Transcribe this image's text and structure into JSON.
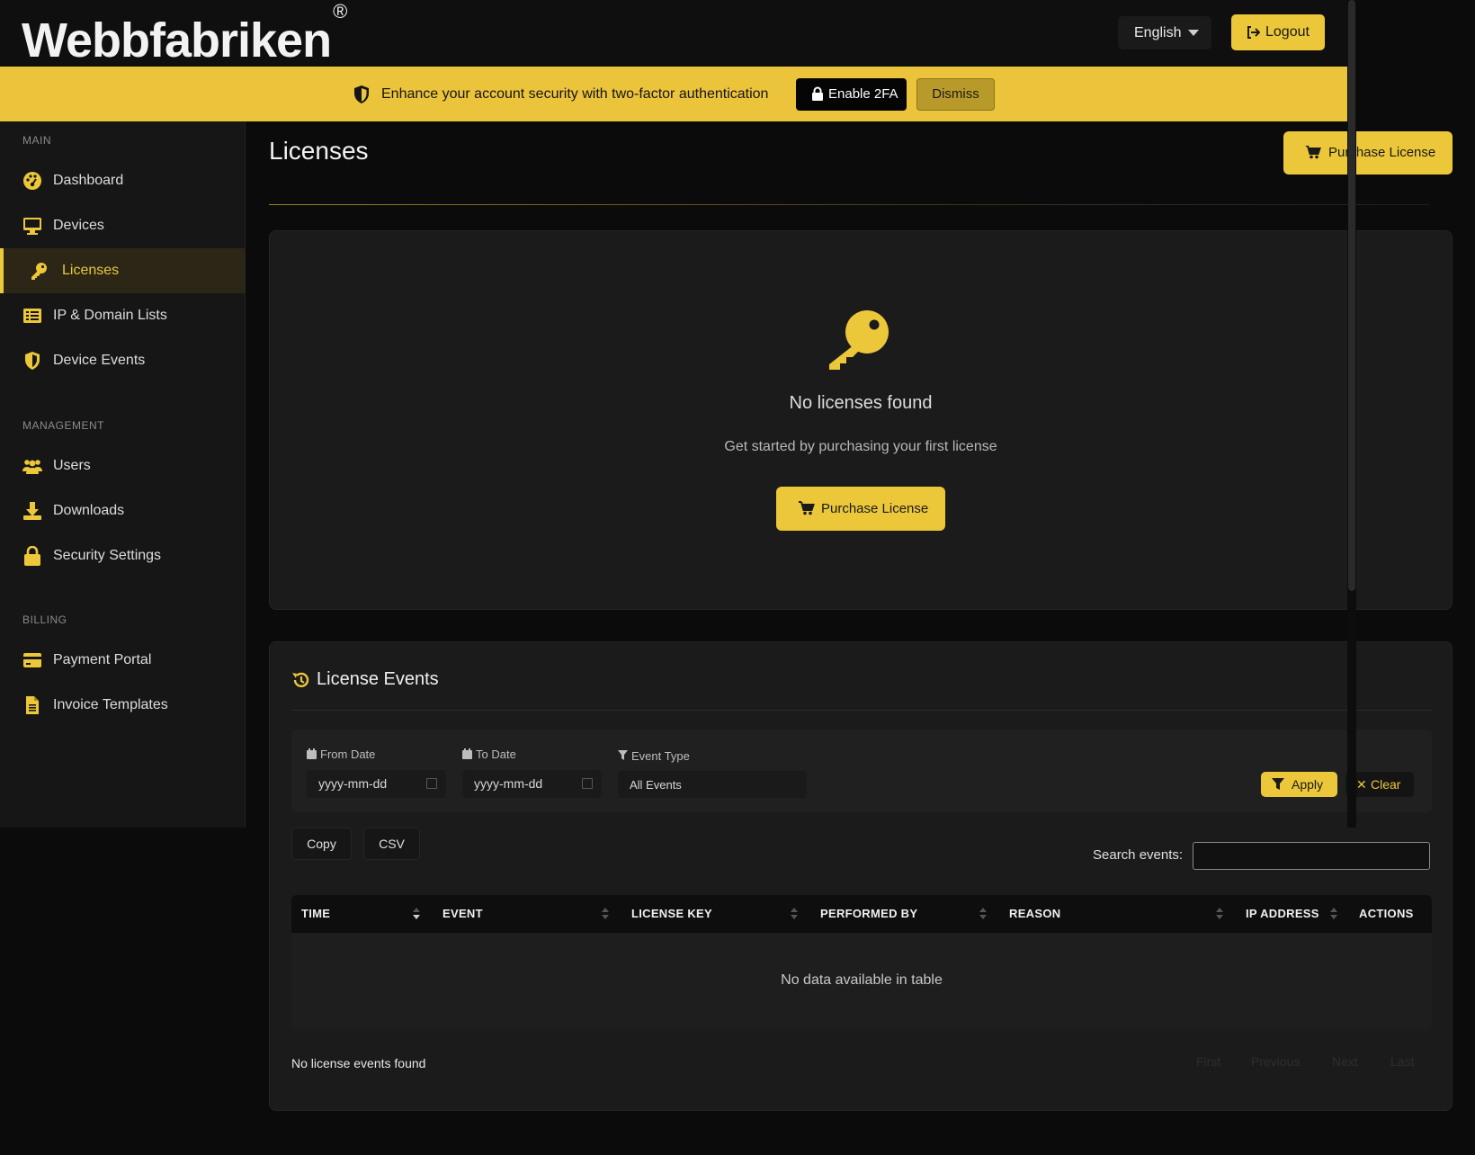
{
  "brand": {
    "name": "Webbfabriken",
    "mark": "®"
  },
  "header": {
    "language": "English",
    "logout_label": "Logout"
  },
  "banner": {
    "message": "Enhance your account security with two-factor authentication",
    "enable_label": "Enable 2FA",
    "dismiss_label": "Dismiss"
  },
  "sidebar": {
    "sections": [
      {
        "label": "MAIN",
        "items": [
          {
            "label": "Dashboard",
            "icon": "dashboard-icon"
          },
          {
            "label": "Devices",
            "icon": "monitor-icon"
          },
          {
            "label": "Licenses",
            "icon": "key-icon",
            "active": true
          },
          {
            "label": "IP & Domain Lists",
            "icon": "list-icon"
          },
          {
            "label": "Device Events",
            "icon": "shield-icon"
          }
        ]
      },
      {
        "label": "MANAGEMENT",
        "items": [
          {
            "label": "Users",
            "icon": "users-icon"
          },
          {
            "label": "Downloads",
            "icon": "download-icon"
          },
          {
            "label": "Security Settings",
            "icon": "lock-icon"
          }
        ]
      },
      {
        "label": "BILLING",
        "items": [
          {
            "label": "Payment Portal",
            "icon": "credit-card-icon"
          },
          {
            "label": "Invoice Templates",
            "icon": "file-icon"
          }
        ]
      }
    ]
  },
  "main": {
    "title": "Licenses",
    "purchase_label": "Purchase License",
    "empty": {
      "title": "No licenses found",
      "subtitle": "Get started by purchasing your first license",
      "button_label": "Purchase License"
    }
  },
  "events": {
    "title": "License Events",
    "filters": {
      "from_label": "From Date",
      "from_placeholder": "yyyy-mm-dd",
      "to_label": "To Date",
      "to_placeholder": "yyyy-mm-dd",
      "type_label": "Event Type",
      "type_value": "All Events",
      "apply_label": "Apply",
      "clear_label": "Clear"
    },
    "copy_label": "Copy",
    "csv_label": "CSV",
    "search_label": "Search events:",
    "columns": [
      "TIME",
      "EVENT",
      "LICENSE KEY",
      "PERFORMED BY",
      "REASON",
      "IP ADDRESS",
      "ACTIONS"
    ],
    "empty_row": "No data available in table",
    "info": "No license events found",
    "pagination": [
      "First",
      "Previous",
      "Next",
      "Last"
    ]
  },
  "colors": {
    "accent": "#ecc73a",
    "background": "#0b0b0b",
    "card": "#1b1b1b"
  }
}
